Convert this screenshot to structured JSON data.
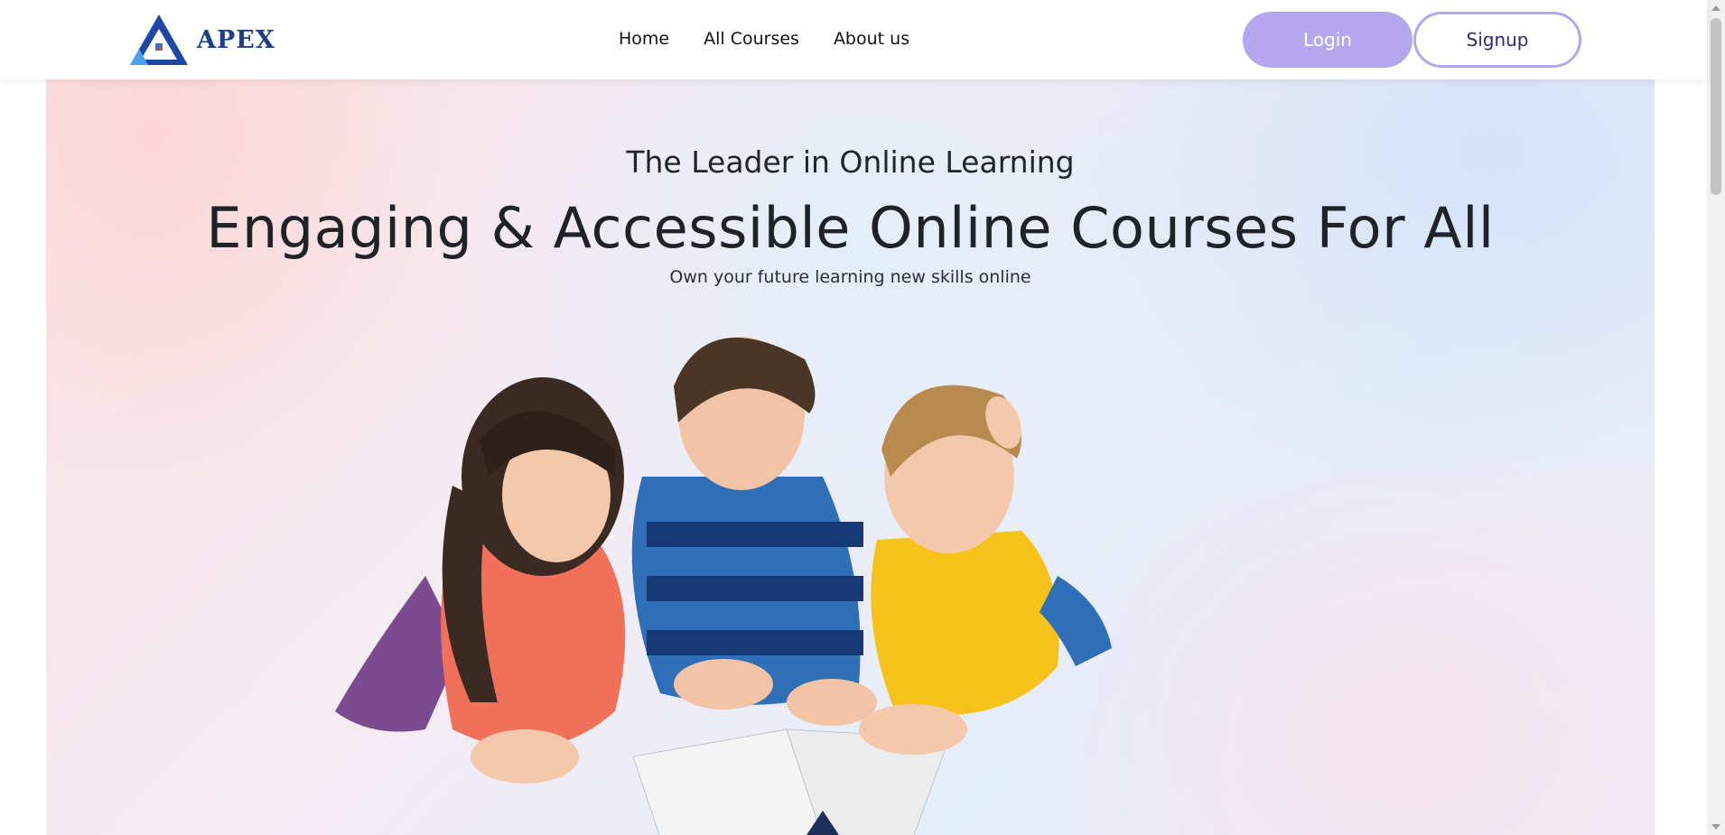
{
  "brand": {
    "name": "APEX",
    "icon": "apex-triangle-logo",
    "color": "#1e3f8c"
  },
  "nav": {
    "items": [
      {
        "label": "Home"
      },
      {
        "label": "All Courses"
      },
      {
        "label": "About us"
      }
    ]
  },
  "auth": {
    "login_label": "Login",
    "signup_label": "Signup",
    "accent": "#b4a7f0"
  },
  "hero": {
    "subtitle": "The Leader in Online Learning",
    "title": "Engaging & Accessible Online Courses For All",
    "tagline": "Own your future learning new skills online",
    "image_icon": "children-reading-book-illustration"
  }
}
